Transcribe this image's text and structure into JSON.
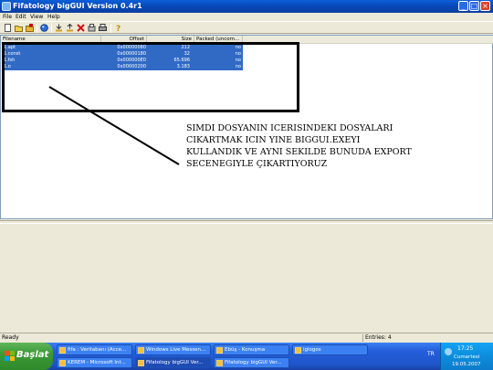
{
  "window": {
    "title": "Fifatology bigGUI Version 0.4r1",
    "minimize": "_",
    "maximize": "□",
    "close": "×"
  },
  "menu": [
    "File",
    "Edit",
    "View",
    "Help"
  ],
  "toolbar_icons": [
    "new-icon",
    "open-icon",
    "save-icon",
    "globe-icon",
    "import-icon",
    "export-icon",
    "delete-icon",
    "pack-icon",
    "print-icon",
    "help-icon"
  ],
  "list": {
    "columns": [
      "Filename",
      "Offset",
      "Size",
      "Packed (uncom..."
    ],
    "rows": [
      {
        "name": "1.apt",
        "offset": "0x00000080",
        "size": "212",
        "packed": "no"
      },
      {
        "name": "1.const",
        "offset": "0x00000180",
        "size": "32",
        "packed": "no"
      },
      {
        "name": "1.fsh",
        "offset": "0x000000E0",
        "size": "65.696",
        "packed": "no"
      },
      {
        "name": "1.o",
        "offset": "0x00000200",
        "size": "3.183",
        "packed": "no"
      }
    ]
  },
  "annotation": {
    "text": "SIMDI DOSYANIN ICERISINDEKI DOSYALARI\nCIKARTMAK ICIN YINE BIGGUI.EXEYI\nKULLANDIK VE AYNI SEKILDE BUNUDA EXPORT\nSECENEGIYLE ÇIKARTIYORUZ"
  },
  "status": {
    "left": "Ready",
    "right": "Entries: 4"
  },
  "taskbar": {
    "start": "Başlat",
    "tasks_row1": [
      "fifa : Veritabanı (Acce...",
      "Windows Live Messen...",
      "Ebüş - Konuşma",
      "iglogos"
    ],
    "tasks_row2": [
      "KEREM - Microsoft Int...",
      "Fifatology bigGUI Ver...",
      "Fifatology bigGUI Ver..."
    ],
    "lang": "TR",
    "time": "17:25",
    "day": "Cumartesi",
    "date": "19.05.2007"
  },
  "colors": {
    "titlebar": "#0a5fd8",
    "selection": "#316ac5",
    "taskbar": "#245edb",
    "start": "#3c9a37"
  }
}
